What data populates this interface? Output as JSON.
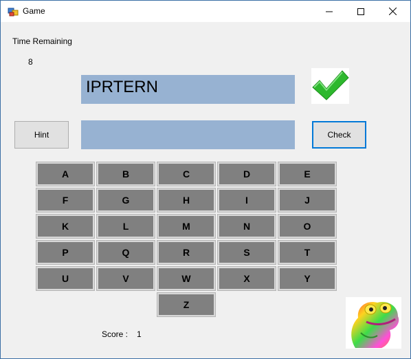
{
  "window": {
    "title": "Game"
  },
  "labels": {
    "time_remaining": "Time Remaining",
    "time_value": "8",
    "score_label": "Score :",
    "score_value": "1"
  },
  "word": {
    "scrambled": "IPRTERN",
    "answer": ""
  },
  "buttons": {
    "hint": "Hint",
    "check": "Check"
  },
  "keyboard": {
    "rows": [
      [
        "A",
        "B",
        "C",
        "D",
        "E"
      ],
      [
        "F",
        "G",
        "H",
        "I",
        "J"
      ],
      [
        "K",
        "L",
        "M",
        "N",
        "O"
      ],
      [
        "P",
        "Q",
        "R",
        "S",
        "T"
      ],
      [
        "U",
        "V",
        "W",
        "X",
        "Y"
      ],
      [
        "",
        "",
        "Z",
        "",
        ""
      ]
    ]
  },
  "colors": {
    "panel": "#97b2d2",
    "key": "#808080",
    "accent": "#0078d7",
    "checkmark": "#2eb82e"
  },
  "icons": {
    "correct": "checkmark-icon",
    "mascot": "frog-image"
  }
}
